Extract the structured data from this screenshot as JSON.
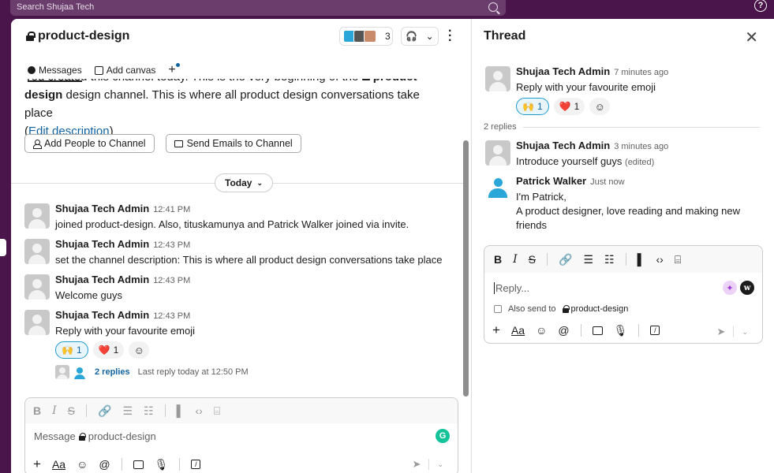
{
  "search": {
    "placeholder": "Search Shujaa Tech"
  },
  "help_label": "?",
  "channel": {
    "name": "product-design",
    "member_count": "3",
    "tabs": [
      {
        "label": "Messages"
      },
      {
        "label": "Add canvas"
      }
    ],
    "intro_line1": "You created this channel today. This is the very beginning of the",
    "intro_channel": "product-",
    "intro_line2": "design channel. This is where all product design conversations take place",
    "intro_paren_open": "(",
    "edit_description": "Edit description",
    "intro_paren_close": ")",
    "add_people_label": "Add People to Channel",
    "send_emails_label": "Send Emails to Channel",
    "day_label": "Today",
    "messages": [
      {
        "author": "Shujaa Tech Admin",
        "time": "12:41 PM",
        "text": "joined product-design. Also, tituskamunya and Patrick Walker joined via invite."
      },
      {
        "author": "Shujaa Tech Admin",
        "time": "12:43 PM",
        "text": "set the channel description: This is where all product design conversations take place"
      },
      {
        "author": "Shujaa Tech Admin",
        "time": "12:43 PM",
        "text": "Welcome guys"
      },
      {
        "author": "Shujaa Tech Admin",
        "time": "12:43 PM",
        "text": "Reply with your favourite emoji"
      }
    ],
    "reactions": [
      {
        "emoji": "🙌",
        "count": "1"
      },
      {
        "emoji": "❤️",
        "count": "1"
      }
    ],
    "replies_link": "2 replies",
    "last_reply": "Last reply today at 12:50 PM",
    "composer_placeholder": "Message",
    "composer_channel": "product-design"
  },
  "thread": {
    "title": "Thread",
    "parent": {
      "author": "Shujaa Tech Admin",
      "time": "7 minutes ago",
      "text": "Reply with your favourite emoji"
    },
    "reactions": [
      {
        "emoji": "🙌",
        "count": "1"
      },
      {
        "emoji": "❤️",
        "count": "1"
      }
    ],
    "replies_count": "2 replies",
    "replies": [
      {
        "author": "Shujaa Tech Admin",
        "time": "3 minutes ago",
        "text": "Introduce yourself guys",
        "edited": "(edited)"
      },
      {
        "author": "Patrick Walker",
        "time": "Just now",
        "text_line1": "I'm Patrick,",
        "text_line2": "A product designer, love reading and making new friends"
      }
    ],
    "reply_placeholder": "Reply...",
    "also_send_label": "Also send to",
    "also_send_channel": "product-design"
  },
  "icons": {
    "grammarly": "G",
    "w": "w"
  },
  "colors": {
    "aubergine": "#4a154b",
    "link": "#1264a3",
    "grammarly": "#15c39a"
  }
}
